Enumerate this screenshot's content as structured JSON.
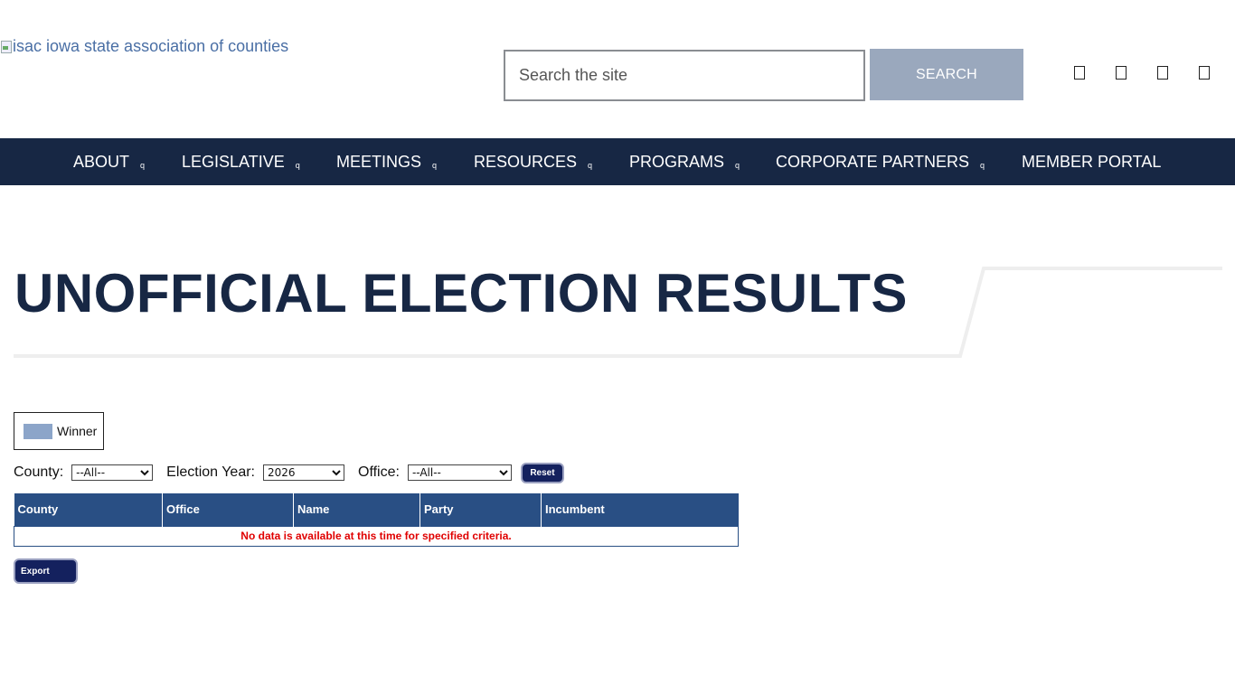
{
  "header": {
    "logo_alt": "isac iowa state association of counties",
    "search_placeholder": "Search the site",
    "search_button": "SEARCH",
    "social_icons": [
      "facebook-icon",
      "twitter-icon",
      "linkedin-icon",
      "youtube-icon"
    ]
  },
  "nav": {
    "items": [
      {
        "label": "ABOUT",
        "has_dropdown": true
      },
      {
        "label": "LEGISLATIVE",
        "has_dropdown": true
      },
      {
        "label": "MEETINGS",
        "has_dropdown": true
      },
      {
        "label": "RESOURCES",
        "has_dropdown": true
      },
      {
        "label": "PROGRAMS",
        "has_dropdown": true
      },
      {
        "label": "CORPORATE PARTNERS",
        "has_dropdown": true
      },
      {
        "label": "MEMBER PORTAL",
        "has_dropdown": false
      }
    ],
    "caret_glyph": "q"
  },
  "page": {
    "title": "UNOFFICIAL ELECTION RESULTS"
  },
  "legend": {
    "winner_label": "Winner",
    "winner_color": "#8ca5c9"
  },
  "filters": {
    "county_label": "County:",
    "county_value": "--All--",
    "year_label": "Election Year:",
    "year_value": "2026",
    "office_label": "Office:",
    "office_value": "--All--",
    "reset_label": "Reset"
  },
  "table": {
    "columns": [
      "County",
      "Office",
      "Name",
      "Party",
      "Incumbent"
    ],
    "empty_message": "No data is available at this time for specified criteria."
  },
  "export_label": "Export",
  "colors": {
    "navy": "#172744",
    "table_header": "#294f84",
    "button_navy": "#14215e",
    "search_button": "#9aa8bd",
    "error_red": "#e00000"
  }
}
